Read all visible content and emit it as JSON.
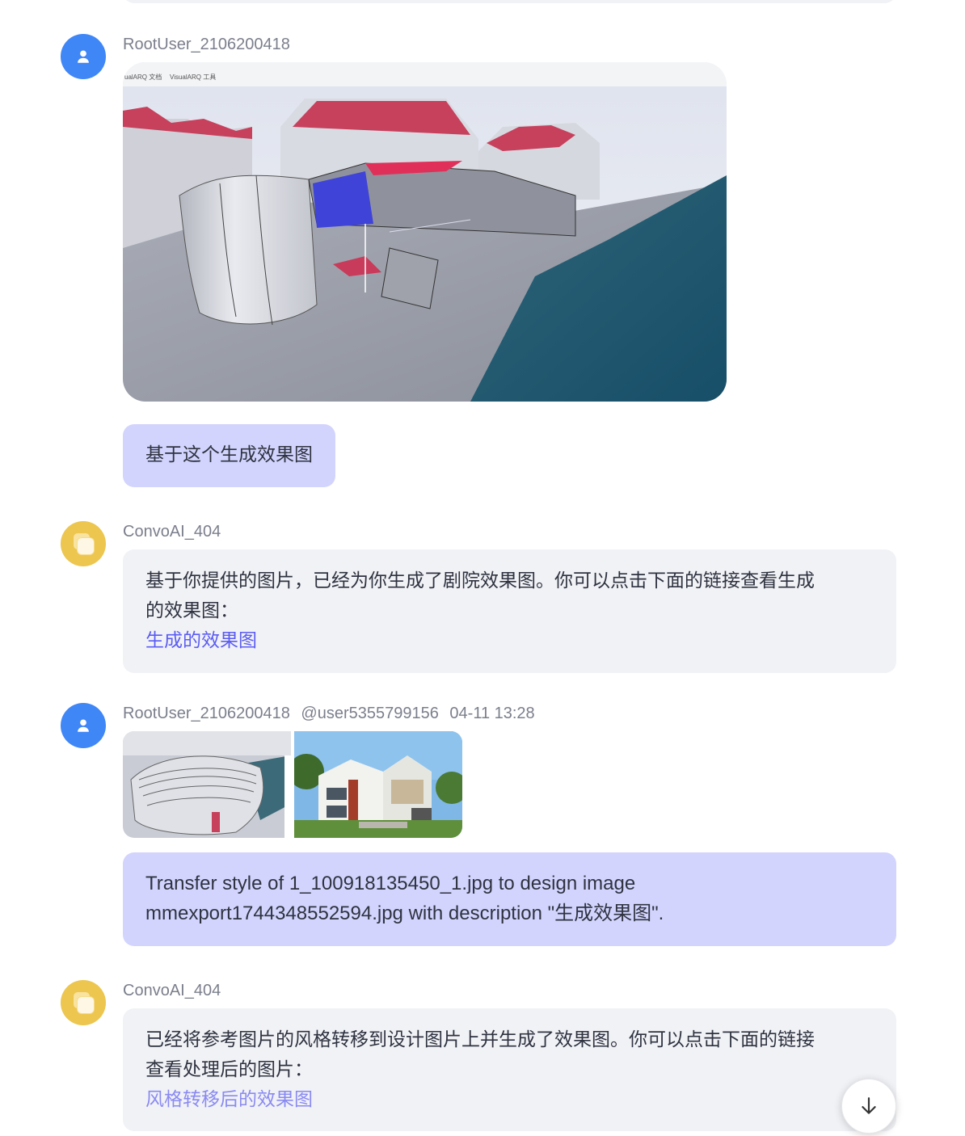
{
  "messages": [
    {
      "sender": "RootUser_2106200418",
      "toolbar_tabs": [
        "ualARQ 文档",
        "VisualARQ 工具"
      ],
      "text": "基于这个生成效果图"
    },
    {
      "sender": "ConvoAI_404",
      "text_line1": "基于你提供的图片，已经为你生成了剧院效果图。你可以点击下面的链接查看生成",
      "text_line2": "的效果图：",
      "link": "生成的效果图"
    },
    {
      "sender": "RootUser_2106200418",
      "mention": "@user5355799156",
      "time": "04-11 13:28",
      "text_line1": "Transfer style of 1_100918135450_1.jpg to design image",
      "text_line2": "mmexport1744348552594.jpg with description \"生成效果图\"."
    },
    {
      "sender": "ConvoAI_404",
      "text_line1": "已经将参考图片的风格转移到设计图片上并生成了效果图。你可以点击下面的链接",
      "text_line2": "查看处理后的图片：",
      "link": "风格转移后的效果图"
    }
  ],
  "icons": {
    "user_avatar": "user-silhouette-icon",
    "ai_avatar": "stacked-squares-icon",
    "scroll": "arrow-down-icon"
  },
  "colors": {
    "user_avatar": "#3f86f7",
    "ai_avatar": "#ecc64f",
    "user_bubble": "#d2d4fd",
    "ai_bubble": "#f1f2f6",
    "link": "#5b5cf3"
  }
}
